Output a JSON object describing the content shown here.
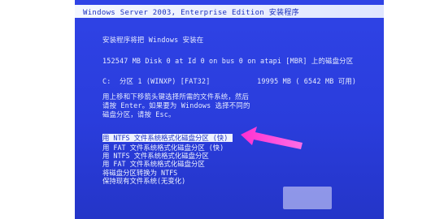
{
  "window": {
    "title": "Windows Server 2003, Enterprise Edition 安装程序"
  },
  "body": {
    "intro": "安装程序将把 Windows 安装在",
    "disk": "152547 MB Disk 0 at Id 0 on bus 0 on atapi [MBR] 上的磁盘分区",
    "partition": "C:  分区 1 (WINXP) [FAT32]           19995 MB ( 6542 MB 可用)",
    "instructions": [
      "用上移和下移箭头键选择所需的文件系统，然后",
      "请按 Enter。如果要为 Windows 选择不同的",
      "磁盘分区，请按 Esc。"
    ]
  },
  "options": [
    "用 NTFS 文件系统格式化磁盘分区 (快)",
    "用 FAT 文件系统格式化磁盘分区 (快)",
    "用 NTFS 文件系统格式化磁盘分区",
    "用 FAT 文件系统格式化磁盘分区",
    "将磁盘分区转换为 NTFS",
    "保持现有文件系统(无变化)"
  ],
  "colors": {
    "screen_bg": "#2a3fe0",
    "text": "#e8edff",
    "highlight_bg": "#eef2ff",
    "highlight_text": "#1f33c6",
    "arrow": "#ff2fd0"
  },
  "selected_option_index": 0
}
